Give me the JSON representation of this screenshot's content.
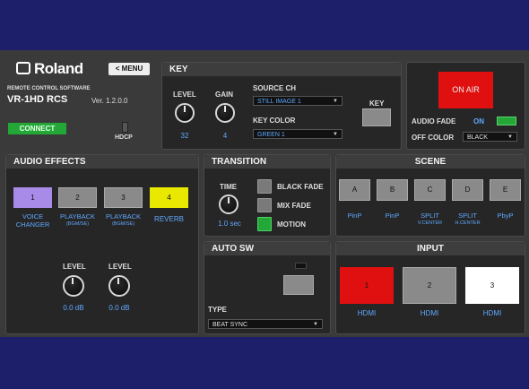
{
  "header": {
    "logo_text": "Roland",
    "menu_label": "< MENU",
    "software_label": "REMOTE CONTROL SOFTWARE",
    "product_name": "VR-1HD RCS",
    "version": "Ver. 1.2.0.0",
    "connect_label": "CONNECT",
    "hdcp_label": "HDCP"
  },
  "key": {
    "title": "KEY",
    "level_label": "LEVEL",
    "level_value": "32",
    "gain_label": "GAIN",
    "gain_value": "4",
    "source_ch_label": "SOURCE CH",
    "source_ch_value": "STILL IMAGE 1",
    "key_color_label": "KEY COLOR",
    "key_color_value": "GREEN 1",
    "key_button_label": "KEY"
  },
  "onair": {
    "on_air_label": "ON AIR",
    "audio_fade_label": "AUDIO FADE",
    "audio_fade_state": "ON",
    "off_color_label": "OFF COLOR",
    "off_color_value": "BLACK"
  },
  "audio_effects": {
    "title": "AUDIO EFFECTS",
    "buttons": [
      {
        "num": "1",
        "line1": "VOICE",
        "line2": "CHANGER"
      },
      {
        "num": "2",
        "line1": "PLAYBACK",
        "line2": "(BGM/SE)"
      },
      {
        "num": "3",
        "line1": "PLAYBACK",
        "line2": "(BGM/SE)"
      },
      {
        "num": "4",
        "line1": "REVERB",
        "line2": ""
      }
    ],
    "level_label": "LEVEL",
    "level1_value": "0.0 dB",
    "level2_value": "0.0 dB"
  },
  "transition": {
    "title": "TRANSITION",
    "time_label": "TIME",
    "time_value": "1.0 sec",
    "options": [
      "BLACK FADE",
      "MIX FADE",
      "MOTION"
    ]
  },
  "auto_sw": {
    "title": "AUTO SW",
    "type_label": "TYPE",
    "type_value": "BEAT SYNC"
  },
  "scene": {
    "title": "SCENE",
    "buttons": [
      {
        "letter": "A",
        "label": "PinP",
        "sub": ""
      },
      {
        "letter": "B",
        "label": "PinP",
        "sub": ""
      },
      {
        "letter": "C",
        "label": "SPLIT",
        "sub": "V.CENTER"
      },
      {
        "letter": "D",
        "label": "SPLIT",
        "sub": "H.CENTER"
      },
      {
        "letter": "E",
        "label": "PbyP",
        "sub": ""
      }
    ]
  },
  "input": {
    "title": "INPUT",
    "buttons": [
      {
        "num": "1",
        "label": "HDMI"
      },
      {
        "num": "2",
        "label": "HDMI"
      },
      {
        "num": "3",
        "label": "HDMI"
      }
    ]
  },
  "colors": {
    "page_bg": "#1d1f6b",
    "accent_blue": "#5fa8ff",
    "on_air_red": "#e01010",
    "green": "#23a838",
    "purple": "#a88be8",
    "yellow": "#e8e800"
  }
}
